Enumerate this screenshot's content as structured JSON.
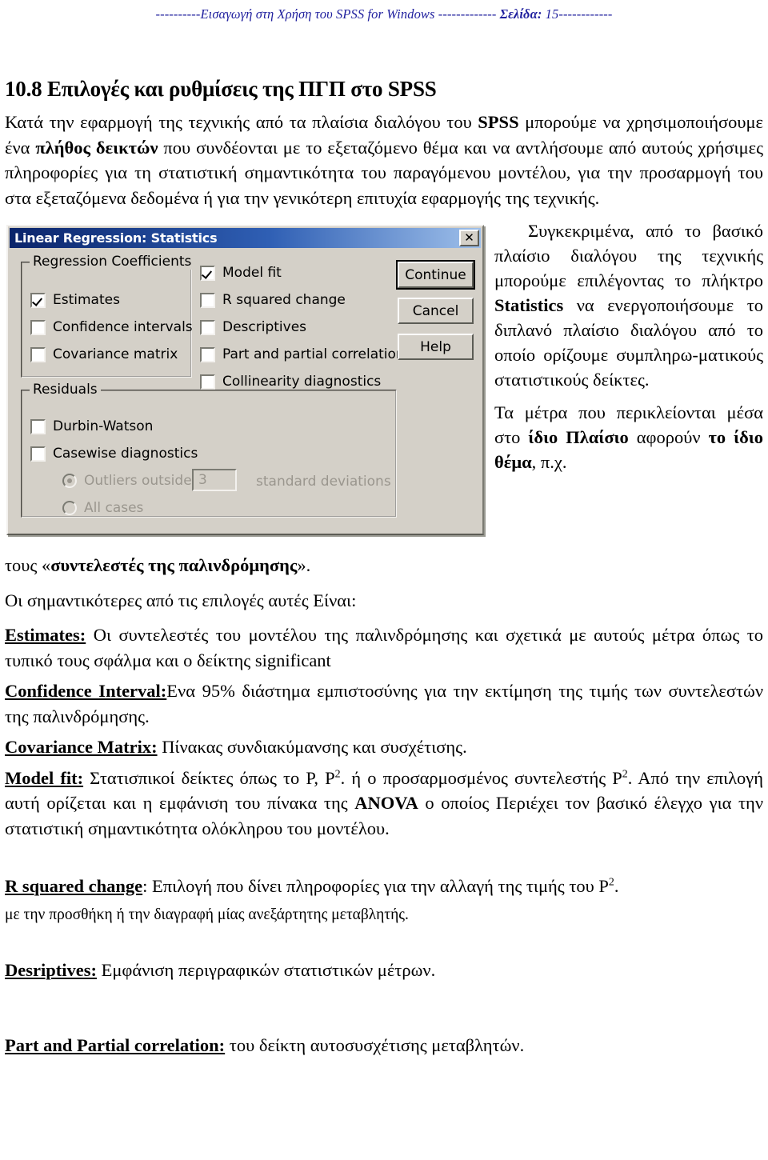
{
  "header": {
    "prefix_dashes": "----------",
    "text": "Εισαγωγή στη Χρήση του SPSS for Windows -------------",
    "page_label": "Σελίδα:",
    "page_number": " 15------------"
  },
  "document": {
    "section_title": "10.8 Επιλογές και ρυθμίσεις της ΠΓΠ στο SPSS",
    "intro_p1_a": "Κατά την εφαρμογή της τεχνικής από τα πλαίσια διαλόγου του ",
    "intro_p1_b": "SPSS",
    "intro_p1_c": " μπορούμε να χρησιμοποιήσουμε ένα ",
    "intro_p1_d": "πλήθος δεικτών",
    "intro_p1_e": " που συνδέονται με το εξεταζόμενο θέμα και να αντλήσουμε από αυτούς χρήσιμες πληροφορίες για τη στατιστική σημαντικότητα του παραγόμενου μοντέλου, για την προσαρμογή του στα εξεταζόμενα δεδομένα ή για την γενικότερη επιτυχία εφαρμογής της τεχνικής.",
    "side_p1_a": "Συγκεκριμένα, από το βασικό πλαίσιο διαλόγου της τεχνικής μπορούμε επιλέγοντας το πλήκτρο ",
    "side_p1_b": "Statistics",
    "side_p1_c": " να ενεργοποιήσουμε το διπλανό πλαίσιο διαλόγου από το οποίο ορίζουμε συμπληρω-ματικούς στατιστικούς δείκτες.",
    "side_p2_a": "Τα μέτρα που περικλείονται μέσα στο ",
    "side_p2_b": "ίδιο Πλαίσιο",
    "side_p2_c": " αφορούν ",
    "side_p2_d": "το ίδιο θέμα",
    "side_p2_e": ", π.χ.",
    "caption_a": "τους «",
    "caption_b": "συντελεστές της παλινδρόμησης",
    "caption_c": "».",
    "lead_in": "Οι σημαντικότερες από τις επιλογές αυτές Είναι:"
  },
  "dialog": {
    "title": "Linear Regression: Statistics",
    "close_label": "✕",
    "group_coefficients": "Regression Coefficients",
    "group_residuals": "Residuals",
    "checkboxes_left": [
      {
        "label": "Estimates",
        "checked": true
      },
      {
        "label": "Confidence intervals",
        "checked": false
      },
      {
        "label": "Covariance matrix",
        "checked": false
      }
    ],
    "checkboxes_middle": [
      {
        "label": "Model fit",
        "checked": true
      },
      {
        "label": "R squared change",
        "checked": false
      },
      {
        "label": "Descriptives",
        "checked": false
      },
      {
        "label": "Part and partial correlations",
        "checked": false
      },
      {
        "label": "Collinearity diagnostics",
        "checked": false
      }
    ],
    "checkboxes_residuals": [
      {
        "label": "Durbin-Watson",
        "checked": false
      },
      {
        "label": "Casewise diagnostics",
        "checked": false
      }
    ],
    "radio_outliers": "Outliers outside",
    "outliers_value": "3",
    "std_dev_label": "standard deviations",
    "radio_all_cases": "All cases",
    "buttons": [
      "Continue",
      "Cancel",
      "Help"
    ],
    "colors": {
      "face": "#d4d0c8",
      "title_start": "#0a246a",
      "title_end": "#9fc0ea"
    }
  },
  "definitions": [
    {
      "term": "Estimates:",
      "body": " Οι συντελεστές του μοντέλου της παλινδρόμησης και σχετικά με αυτούς μέτρα όπως το τυπικό τους σφάλμα και ο δείκτης significant"
    },
    {
      "term": "Confidence Interval:",
      "body": "Ενα 95% διάστημα εμπιστοσύνης για την εκτίμηση της τιμής των συντελεστών της παλινδρόμησης."
    },
    {
      "term": "Covariance Matrix:",
      "body": " Πίνακας συνδιακύμανσης και συσχέτισης."
    }
  ],
  "model_fit": {
    "term": "Model fit:",
    "part1": " Στατισπικοί δείκτες όπως το Ρ, Ρ",
    "sup1": "2",
    "part2": ". ή ο προσαρμοσμένος συντελεστής Ρ",
    "sup2": "2",
    "part3": ". Από την επιλογή αυτή ορίζεται και η εμφάνιση του πίνακα της ",
    "anova": "ANOVA",
    "part4": " ο οποίος Περιέχει τον βασικό έλεγχο για την στατιστική σημαντικότητα ολόκληρου του μοντέλου."
  },
  "r_squared": {
    "term": "R squared change",
    "part1": ":  Επιλογή που δίνει πληροφορίες για την αλλαγή της τιμής του Ρ",
    "sup1": "2",
    "part2": ".",
    "line2": "με την προσθήκη ή την διαγραφή μίας ανεξάρτητης μεταβλητής."
  },
  "descriptives": {
    "term": "Desriptives:",
    "body": " Εμφάνιση περιγραφικών στατιστικών μέτρων."
  },
  "part_partial": {
    "term": "Part and Partial correlation:",
    "body": " του δείκτη αυτοσυσχέτισης μεταβλητών."
  }
}
